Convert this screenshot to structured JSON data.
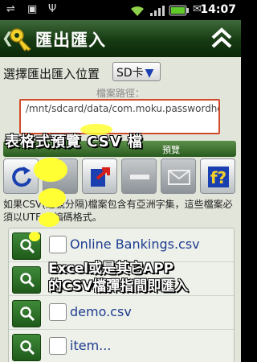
{
  "statusbar": {
    "icons": [
      "usb-icon",
      "android-icon",
      "usb-debug-icon",
      "wifi-icon",
      "signal-icon",
      "battery-icon"
    ],
    "time": "14:07"
  },
  "titlebar": {
    "title": "匯出匯入"
  },
  "location": {
    "label": "選擇匯出匯入位置",
    "selected": "SD卡"
  },
  "path": {
    "label": "檔案路徑：",
    "value": "/mnt/sdcard/data/com.moku.passwordhome/io"
  },
  "preview": {
    "header": "預覽"
  },
  "toolbar": {
    "buttons": [
      "refresh-icon",
      "blank",
      "export-icon",
      "minus-icon",
      "mail-icon",
      "help-icon"
    ]
  },
  "info": {
    "text": "如果CSV(逗號分隔)檔案包含有亞洲字集，這些檔案必須以UTF-8 編碼格式。"
  },
  "files": [
    {
      "name": "Online Bankings.csv"
    },
    {
      "name": ""
    },
    {
      "name": "demo.csv"
    },
    {
      "name": "item..."
    }
  ],
  "annotations": {
    "top": "表格式預覽 CSV 檔",
    "bottom_line1": "Excel或是其它APP",
    "bottom_line2": "的CSV檔彈指間即匯入"
  },
  "colors": {
    "titlebar": "#163a12",
    "accent_green": "#3f8a3a",
    "path_border": "#d24a2a",
    "bubble": "#ffff33"
  }
}
